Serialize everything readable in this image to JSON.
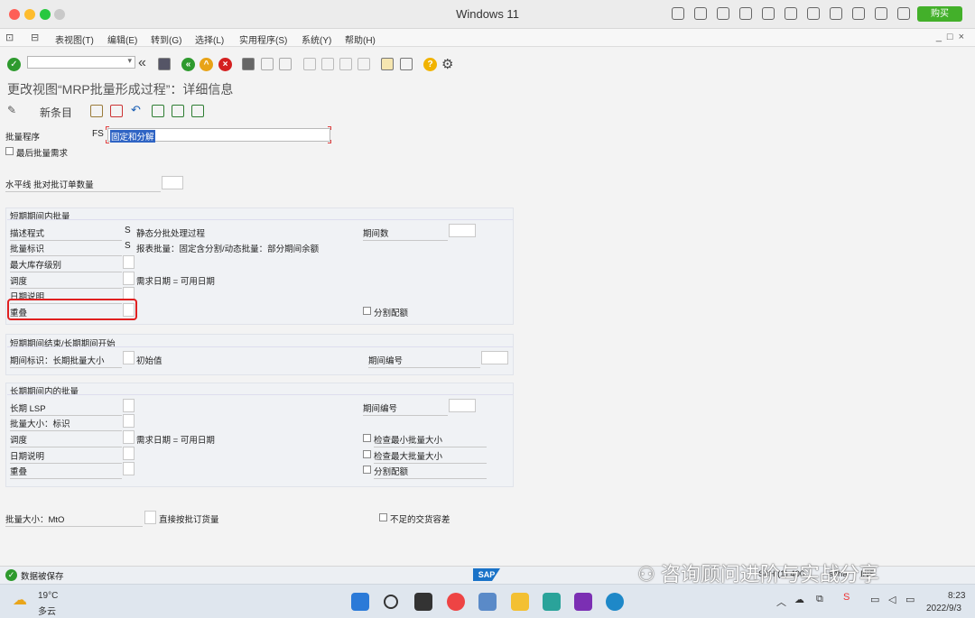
{
  "window": {
    "title": "Windows 11",
    "buy_label": "购买"
  },
  "menu": [
    "表视图(T)",
    "编辑(E)",
    "转到(G)",
    "选择(L)",
    "实用程序(S)",
    "系统(Y)",
    "帮助(H)"
  ],
  "win_controls": "_□×",
  "page_title": "更改视图“MRP批量形成过程”：详细信息",
  "app_toolbar": {
    "new_entries": "新条目"
  },
  "form": {
    "lot_procedure_label": "批量程序",
    "lot_procedure_key": "FS",
    "lot_procedure_text": "固定和分解",
    "last_lot_req": "最后批量需求",
    "horizon_label": "水平线 批对批订单数量",
    "short_term": {
      "header": "短期期间内批量",
      "desc_label": "描述程式",
      "desc_flag": "S",
      "desc_text": "静态分批处理过程",
      "indicator_label": "批量标识",
      "indicator_flag": "S",
      "indicator_text": "报表批量：固定含分割/动态批量：部分期间余额",
      "max_stock_label": "最大库存级别",
      "scheduling_label": "调度",
      "scheduling_text": "需求日期 = 可用日期",
      "date_spec_label": "日期说明",
      "overlap_label": "重叠",
      "periods_label": "期间数",
      "split_quota": "分割配额"
    },
    "transition": {
      "header": "短期期间结束/长期期间开始",
      "period_ind_label": "期间标识：长期批量大小",
      "initial_value": "初始值",
      "period_no_label": "期间编号"
    },
    "long_term": {
      "header": "长期期间内的批量",
      "lsp_label": "长期 LSP",
      "lot_ind_label": "批量大小：标识",
      "scheduling_label": "调度",
      "scheduling_text": "需求日期 = 可用日期",
      "date_spec_label": "日期说明",
      "overlap_label": "重叠",
      "period_no_label": "期间编号",
      "check_min": "检查最小批量大小",
      "check_max": "检查最大批量大小",
      "split_quota": "分割配额"
    },
    "mto_label": "批量大小：MtO",
    "direct_order": "直接按批订货量",
    "under_delivery": "不足的交货容差"
  },
  "status": {
    "message": "数据被保存",
    "sap": "SAP",
    "system": "S4H (1) 400",
    "host": "s4ha",
    "mode": "INS"
  },
  "watermark": "咨询顾问进阶与实战分享",
  "taskbar": {
    "temp": "19°C",
    "weather": "多云",
    "time": "8:23",
    "date": "2022/9/3"
  },
  "colors": {
    "ok_green": "#2e9a2e",
    "highlight_red": "#e02020",
    "selection_blue": "#2f64c4"
  }
}
